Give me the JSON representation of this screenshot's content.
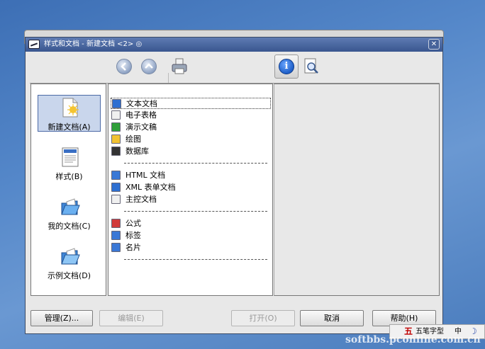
{
  "window": {
    "title": "样式和文档 - 新建文档 <2> ◎",
    "close_glyph": "✕"
  },
  "toolbar": {
    "back_icon": "back-arrow-icon",
    "up_icon": "up-arrow-icon",
    "print_icon": "printer-icon",
    "info_icon": "info-icon",
    "preview_icon": "magnifier-page-icon",
    "info_glyph": "i"
  },
  "categories": [
    {
      "label": "新建文档(A)",
      "icon": "new-document-icon",
      "selected": true
    },
    {
      "label": "样式(B)",
      "icon": "styles-document-icon",
      "selected": false
    },
    {
      "label": "我的文档(C)",
      "icon": "my-documents-folder-icon",
      "selected": false
    },
    {
      "label": "示例文档(D)",
      "icon": "sample-documents-folder-icon",
      "selected": false
    }
  ],
  "items": {
    "group1": [
      {
        "label": "文本文档",
        "icon": "text-document-icon",
        "color": "#2d6fd1"
      },
      {
        "label": "电子表格",
        "icon": "spreadsheet-icon",
        "color": "#f0f0f0"
      },
      {
        "label": "演示文稿",
        "icon": "presentation-icon",
        "color": "#2f9f3a"
      },
      {
        "label": "绘图",
        "icon": "drawing-icon",
        "color": "#f1c232"
      },
      {
        "label": "数据库",
        "icon": "database-icon",
        "color": "#333333"
      }
    ],
    "group2": [
      {
        "label": "HTML 文档",
        "icon": "html-document-icon",
        "color": "#3a78d6"
      },
      {
        "label": "XML 表单文档",
        "icon": "xml-form-icon",
        "color": "#2d6fd1"
      },
      {
        "label": "主控文档",
        "icon": "master-document-icon",
        "color": "#f0f0f0"
      }
    ],
    "group3": [
      {
        "label": "公式",
        "icon": "formula-icon",
        "color": "#d13b3b"
      },
      {
        "label": "标签",
        "icon": "labels-icon",
        "color": "#3a78d6"
      },
      {
        "label": "名片",
        "icon": "business-cards-icon",
        "color": "#3a78d6"
      }
    ]
  },
  "buttons": {
    "manage": "管理(Z)...",
    "edit": "编辑(E)",
    "open": "打开(O)",
    "cancel": "取消",
    "help": "帮助(H)"
  },
  "ime": {
    "logo": "五",
    "mode": "五笔字型",
    "lang": "中",
    "moon": "☽"
  },
  "watermark": "softbbs.pconline.com.cn"
}
